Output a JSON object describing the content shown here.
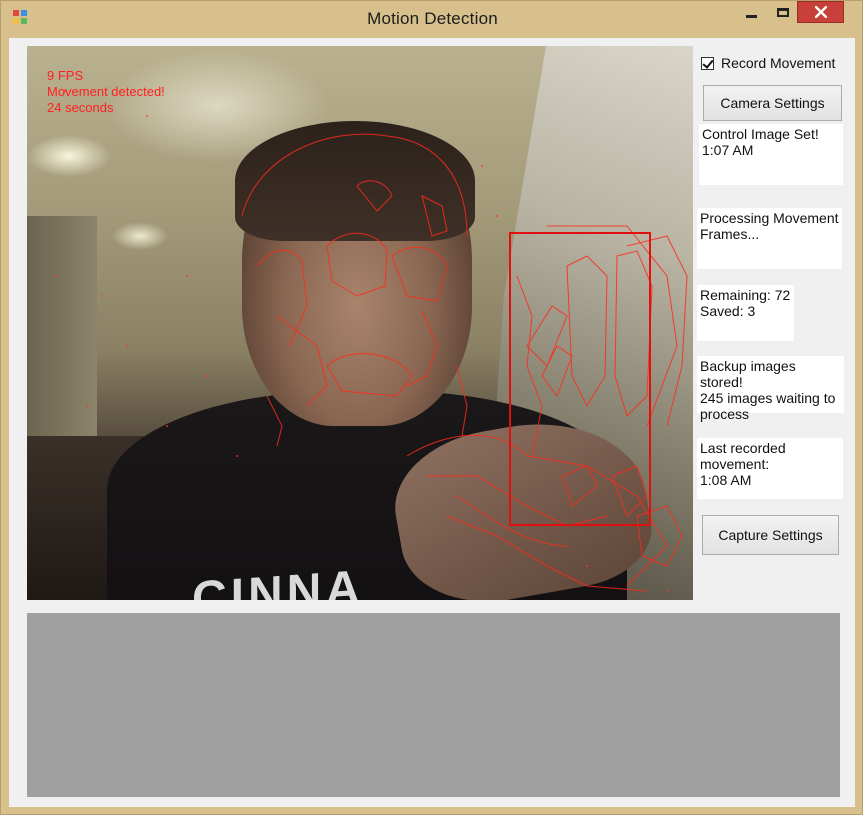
{
  "window": {
    "title": "Motion Detection"
  },
  "video_overlay": {
    "fps": "9 FPS",
    "status": "Movement detected!",
    "duration": "24 seconds",
    "shirt_text": "CINNA"
  },
  "controls": {
    "record_movement_label": "Record Movement",
    "record_movement_checked": true,
    "camera_settings_label": "Camera Settings",
    "capture_settings_label": "Capture Settings"
  },
  "info": {
    "control_image": "Control Image Set!\n1:07 AM",
    "processing": "Processing Movement\nFrames...",
    "remaining": "Remaining: 72\nSaved: 3",
    "backup": "Backup images stored!\n245 images waiting to\nprocess",
    "last_recorded": "Last recorded\nmovement:\n1:08 AM"
  },
  "colors": {
    "overlay_text": "#ff2020",
    "motion_box": "#e01010",
    "bottom_panel": "#a0a0a0"
  }
}
